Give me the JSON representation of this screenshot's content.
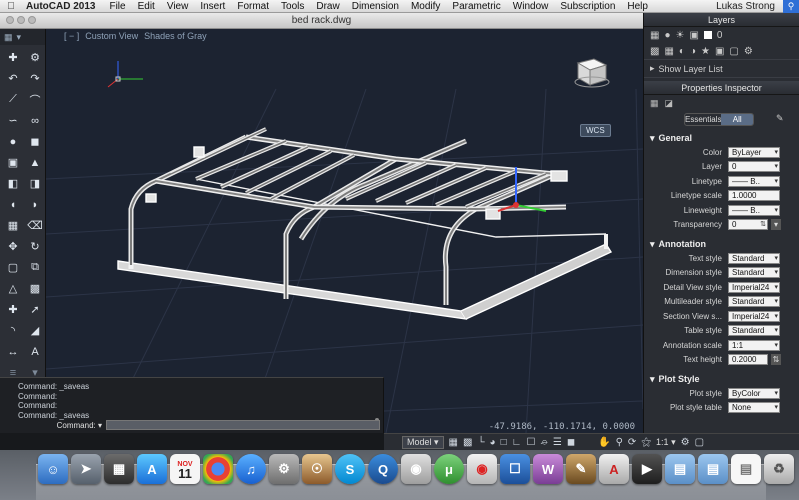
{
  "menubar": {
    "apple": "",
    "app": "AutoCAD 2013",
    "items": [
      "File",
      "Edit",
      "View",
      "Insert",
      "Format",
      "Tools",
      "Draw",
      "Dimension",
      "Modify",
      "Parametric",
      "Window",
      "Subscription",
      "Help"
    ],
    "user": "Lukas Strong"
  },
  "document": {
    "title": "bed rack.dwg"
  },
  "viewport": {
    "view": "Custom View",
    "visual_style": "Shades of Gray",
    "viewcube_top": "TOP",
    "viewcube_front": "FRONT",
    "viewcube_right": "RIGHT",
    "wcs": "WCS",
    "coordinates": "-47.9186, -110.1714, 0.0000"
  },
  "layers": {
    "title": "Layers",
    "current_layer": "0",
    "show_list": "Show Layer List"
  },
  "properties": {
    "title": "Properties Inspector",
    "tab_essentials": "Essentials",
    "tab_all": "All",
    "sections": [
      {
        "name": "General",
        "rows": [
          {
            "label": "Color",
            "value": "ByLayer"
          },
          {
            "label": "Layer",
            "value": "0"
          },
          {
            "label": "Linetype",
            "value": "—— B.."
          },
          {
            "label": "Linetype scale",
            "value": "1.0000"
          },
          {
            "label": "Lineweight",
            "value": "—— B.."
          },
          {
            "label": "Transparency",
            "value": "0"
          }
        ]
      },
      {
        "name": "Annotation",
        "rows": [
          {
            "label": "Text style",
            "value": "Standard"
          },
          {
            "label": "Dimension style",
            "value": "Standard"
          },
          {
            "label": "Detail View style",
            "value": "Imperial24"
          },
          {
            "label": "Multileader style",
            "value": "Standard"
          },
          {
            "label": "Section View s...",
            "value": "Imperial24"
          },
          {
            "label": "Table style",
            "value": "Standard"
          },
          {
            "label": "Annotation scale",
            "value": "1:1"
          },
          {
            "label": "Text height",
            "value": "0.2000"
          }
        ]
      },
      {
        "name": "Plot Style",
        "rows": [
          {
            "label": "Plot style",
            "value": "ByColor"
          },
          {
            "label": "Plot style table",
            "value": "None"
          }
        ]
      }
    ]
  },
  "command": {
    "history": [
      "Command: _saveas",
      "Command:",
      "Command:",
      "Command: _saveas"
    ],
    "prompt": "Command:"
  },
  "status": {
    "model": "Model",
    "scale": "1:1"
  },
  "dock": {
    "calendar_month": "NOV",
    "calendar_day": "11"
  },
  "colors": {
    "viewport_bg": "#1c2331",
    "panel_bg": "#2a2d33",
    "model_white": "#f2f2f2",
    "ucs_x": "#d33",
    "ucs_y": "#3c3",
    "ucs_z": "#36f"
  }
}
